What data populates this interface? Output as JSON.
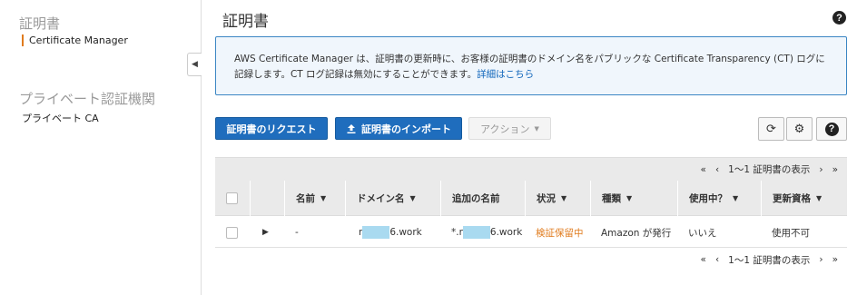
{
  "sidebar": {
    "section1_title": "証明書",
    "item1": "Certificate Manager",
    "section2_title": "プライベート認証機関",
    "item2": "プライベート CA"
  },
  "header": {
    "title": "証明書"
  },
  "info": {
    "text": "AWS Certificate Manager は、証明書の更新時に、お客様の証明書のドメイン名をパブリックな Certificate Transparency (CT) ログに記録します。CT ログ記録は無効にすることができます。",
    "link": "詳細はこちら"
  },
  "toolbar": {
    "request_label": "証明書のリクエスト",
    "import_label": "証明書のインポート",
    "actions_label": "アクション"
  },
  "pager": {
    "text": "1〜1 証明書の表示"
  },
  "table": {
    "columns": [
      "名前",
      "ドメイン名",
      "追加の名前",
      "状況",
      "種類",
      "使用中？",
      "更新資格"
    ],
    "rows": [
      {
        "name": "-",
        "domain_prefix": "r",
        "domain_suffix": "6.work",
        "additional_prefix": "*.r",
        "additional_suffix": "6.work",
        "status": "検証保留中",
        "type": "Amazon が発行",
        "in_use": "いいえ",
        "renewal": "使用不可"
      }
    ]
  },
  "colors": {
    "accent": "#e07b1d",
    "primary": "#1f6dbd",
    "link": "#1166bb"
  },
  "icons": [
    "chevron-left-icon",
    "upload-icon",
    "refresh-icon",
    "gear-icon",
    "help-icon",
    "caret-down-icon",
    "expand-caret-icon"
  ]
}
